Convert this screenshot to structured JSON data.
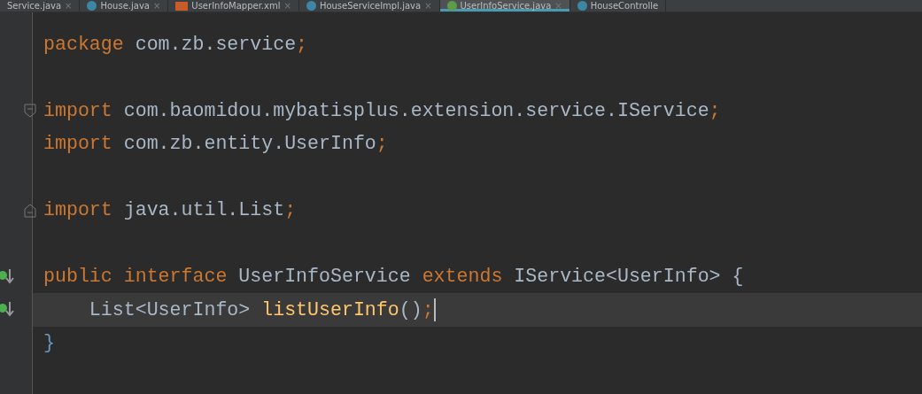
{
  "tabs": [
    {
      "label": "Service.java",
      "close": "×",
      "selected": false
    },
    {
      "label": "House.java",
      "kind": "class",
      "close": "×",
      "selected": false
    },
    {
      "label": "UserInfoMapper.xml",
      "kind": "xml",
      "close": "×",
      "selected": false
    },
    {
      "label": "HouseServiceImpl.java",
      "kind": "class",
      "close": "×",
      "selected": false
    },
    {
      "label": "UserInfoService.java",
      "kind": "interface",
      "close": "×",
      "selected": true
    },
    {
      "label": "HouseControlle",
      "kind": "class",
      "selected": false
    }
  ],
  "lines": [
    {
      "kind": "plain",
      "tokens": [
        {
          "text": "package",
          "kind": "keyword"
        },
        {
          "text": " com.zb.service",
          "kind": "plain"
        },
        {
          "text": ";",
          "kind": "keyword"
        }
      ],
      "current": false,
      "caret": false
    },
    {
      "kind": "plain",
      "current": false,
      "caret": false
    },
    {
      "kind": "fold-start",
      "tokens": [
        {
          "text": "import",
          "kind": "keyword"
        },
        {
          "text": " com.baomidou.mybatisplus.extension.service.IService",
          "kind": "plain"
        },
        {
          "text": ";",
          "kind": "keyword"
        }
      ],
      "current": false,
      "caret": false
    },
    {
      "kind": "plain",
      "tokens": [
        {
          "text": "import",
          "kind": "keyword"
        },
        {
          "text": " com.zb.entity.UserInfo",
          "kind": "plain"
        },
        {
          "text": ";",
          "kind": "keyword"
        }
      ],
      "current": false,
      "caret": false
    },
    {
      "kind": "plain",
      "current": false,
      "caret": false
    },
    {
      "kind": "fold-end",
      "tokens": [
        {
          "text": "import",
          "kind": "keyword"
        },
        {
          "text": " java.util.List",
          "kind": "plain"
        },
        {
          "text": ";",
          "kind": "keyword"
        }
      ],
      "current": false,
      "caret": false
    },
    {
      "kind": "plain",
      "current": false,
      "caret": false
    },
    {
      "kind": "implements",
      "tokens": [
        {
          "text": "public interface",
          "kind": "keyword"
        },
        {
          "text": " UserInfoService ",
          "kind": "plain"
        },
        {
          "text": "extends",
          "kind": "keyword"
        },
        {
          "text": " IService<UserInfo> {",
          "kind": "plain"
        }
      ],
      "current": false,
      "caret": false
    },
    {
      "kind": "implements",
      "tokens": [
        {
          "text": "    List<UserInfo> ",
          "kind": "plain"
        },
        {
          "text": "listUserInfo",
          "kind": "method"
        },
        {
          "text": "()",
          "kind": "plain"
        },
        {
          "text": ";",
          "kind": "keyword"
        }
      ],
      "current": true,
      "caret": true
    },
    {
      "kind": "plain",
      "tokens": [
        {
          "text": "}",
          "kind": "brace"
        }
      ],
      "current": false,
      "caret": false
    }
  ]
}
